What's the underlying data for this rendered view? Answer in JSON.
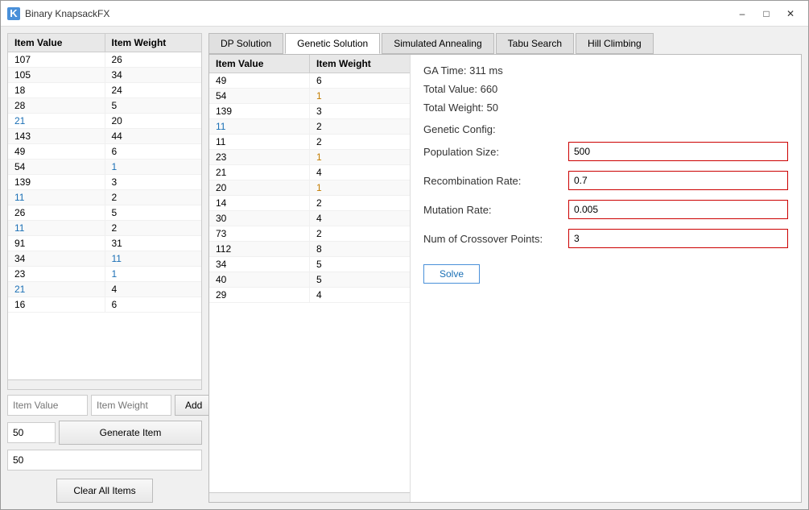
{
  "window": {
    "title": "Binary KnapsackFX",
    "icon": "K",
    "minimize_label": "–",
    "maximize_label": "□",
    "close_label": "✕"
  },
  "left_table": {
    "headers": [
      "Item Value",
      "Item Weight"
    ],
    "rows": [
      {
        "value": "107",
        "weight": "26",
        "v_blue": false,
        "w_blue": false
      },
      {
        "value": "105",
        "weight": "34",
        "v_blue": false,
        "w_blue": false
      },
      {
        "value": "18",
        "weight": "24",
        "v_blue": false,
        "w_blue": false
      },
      {
        "value": "28",
        "weight": "5",
        "v_blue": false,
        "w_blue": false
      },
      {
        "value": "21",
        "weight": "20",
        "v_blue": true,
        "w_blue": false
      },
      {
        "value": "143",
        "weight": "44",
        "v_blue": false,
        "w_blue": false
      },
      {
        "value": "49",
        "weight": "6",
        "v_blue": false,
        "w_blue": false
      },
      {
        "value": "54",
        "weight": "1",
        "v_blue": false,
        "w_blue": true
      },
      {
        "value": "139",
        "weight": "3",
        "v_blue": false,
        "w_blue": false
      },
      {
        "value": "11",
        "weight": "2",
        "v_blue": true,
        "w_blue": false
      },
      {
        "value": "26",
        "weight": "5",
        "v_blue": false,
        "w_blue": false
      },
      {
        "value": "11",
        "weight": "2",
        "v_blue": true,
        "w_blue": false
      },
      {
        "value": "91",
        "weight": "31",
        "v_blue": false,
        "w_blue": false
      },
      {
        "value": "34",
        "weight": "11",
        "v_blue": false,
        "w_blue": true
      },
      {
        "value": "23",
        "weight": "1",
        "v_blue": false,
        "w_blue": true
      },
      {
        "value": "21",
        "weight": "4",
        "v_blue": true,
        "w_blue": false
      },
      {
        "value": "16",
        "weight": "6",
        "v_blue": false,
        "w_blue": false
      }
    ]
  },
  "inputs": {
    "item_value_placeholder": "Item Value",
    "item_weight_placeholder": "Item Weight",
    "add_label": "Add",
    "generate_count_value": "50",
    "generate_btn_label": "Generate Item",
    "knapsack_capacity_value": "50",
    "clear_btn_label": "Clear All Items"
  },
  "tabs": [
    {
      "label": "DP Solution",
      "active": false
    },
    {
      "label": "Genetic Solution",
      "active": true
    },
    {
      "label": "Simulated Annealing",
      "active": false
    },
    {
      "label": "Tabu Search",
      "active": false
    },
    {
      "label": "Hill Climbing",
      "active": false
    }
  ],
  "solution_table": {
    "headers": [
      "Item Value",
      "Item Weight"
    ],
    "rows": [
      {
        "value": "49",
        "weight": "6",
        "v_blue": false,
        "w_blue": false
      },
      {
        "value": "54",
        "weight": "1",
        "v_blue": false,
        "w_blue": true
      },
      {
        "value": "139",
        "weight": "3",
        "v_blue": false,
        "w_blue": false
      },
      {
        "value": "11",
        "weight": "2",
        "v_blue": true,
        "w_blue": false
      },
      {
        "value": "11",
        "weight": "2",
        "v_blue": false,
        "w_blue": false
      },
      {
        "value": "23",
        "weight": "1",
        "v_blue": false,
        "w_blue": true
      },
      {
        "value": "21",
        "weight": "4",
        "v_blue": false,
        "w_blue": false
      },
      {
        "value": "20",
        "weight": "1",
        "v_blue": false,
        "w_blue": true
      },
      {
        "value": "14",
        "weight": "2",
        "v_blue": false,
        "w_blue": false
      },
      {
        "value": "30",
        "weight": "4",
        "v_blue": false,
        "w_blue": false
      },
      {
        "value": "73",
        "weight": "2",
        "v_blue": false,
        "w_blue": false
      },
      {
        "value": "112",
        "weight": "8",
        "v_blue": false,
        "w_blue": false
      },
      {
        "value": "34",
        "weight": "5",
        "v_blue": false,
        "w_blue": false
      },
      {
        "value": "40",
        "weight": "5",
        "v_blue": false,
        "w_blue": false
      },
      {
        "value": "29",
        "weight": "4",
        "v_blue": false,
        "w_blue": false
      }
    ]
  },
  "results": {
    "ga_time_label": "GA Time:",
    "ga_time_value": "311 ms",
    "total_value_label": "Total Value:",
    "total_value_value": "660",
    "total_weight_label": "Total Weight:",
    "total_weight_value": "50",
    "genetic_config_label": "Genetic Config:",
    "population_size_label": "Population Size:",
    "population_size_value": "500",
    "recombination_rate_label": "Recombination Rate:",
    "recombination_rate_value": "0.7",
    "mutation_rate_label": "Mutation Rate:",
    "mutation_rate_value": "0.005",
    "num_crossover_label": "Num of Crossover Points:",
    "num_crossover_value": "3",
    "solve_btn_label": "Solve"
  }
}
